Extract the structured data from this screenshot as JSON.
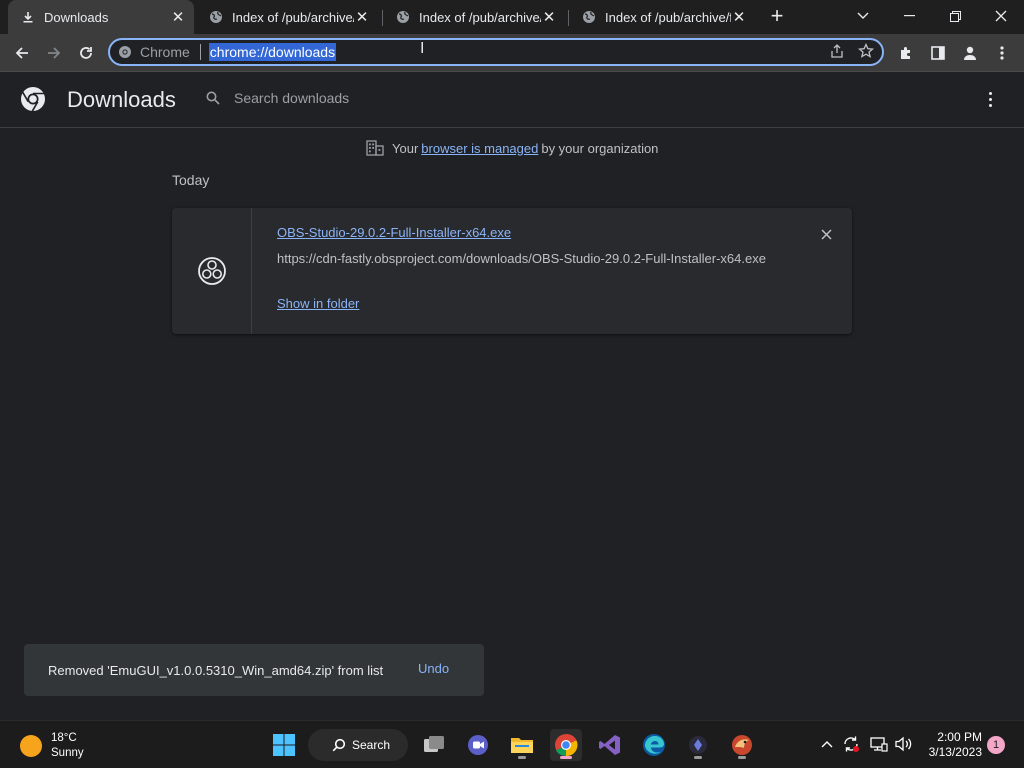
{
  "tabs": [
    {
      "label": "Downloads",
      "icon": "download-icon",
      "active": true
    },
    {
      "label": "Index of /pub/archive/f",
      "icon": "globe-icon",
      "active": false
    },
    {
      "label": "Index of /pub/archive/f",
      "icon": "globe-icon",
      "active": false
    },
    {
      "label": "Index of /pub/archive/f",
      "icon": "globe-icon",
      "active": false
    }
  ],
  "omnibox": {
    "site_label": "Chrome",
    "url": "chrome://downloads"
  },
  "downloads_page": {
    "title": "Downloads",
    "search_placeholder": "Search downloads",
    "managed_prefix": "Your",
    "managed_link": "browser is managed",
    "managed_suffix": "by your organization",
    "section_label": "Today",
    "item": {
      "file_name": "OBS-Studio-29.0.2-Full-Installer-x64.exe",
      "url": "https://cdn-fastly.obsproject.com/downloads/OBS-Studio-29.0.2-Full-Installer-x64.exe",
      "show_in_folder": "Show in folder"
    }
  },
  "toast": {
    "message": "Removed 'EmuGUI_v1.0.0.5310_Win_amd64.zip' from list",
    "undo": "Undo"
  },
  "taskbar": {
    "weather_temp": "18°C",
    "weather_desc": "Sunny",
    "search_label": "Search",
    "time": "2:00 PM",
    "date": "3/13/2023",
    "notification_count": "1"
  },
  "colors": {
    "accent": "#8ab4f8",
    "background": "#202124",
    "card": "#292a2d"
  }
}
